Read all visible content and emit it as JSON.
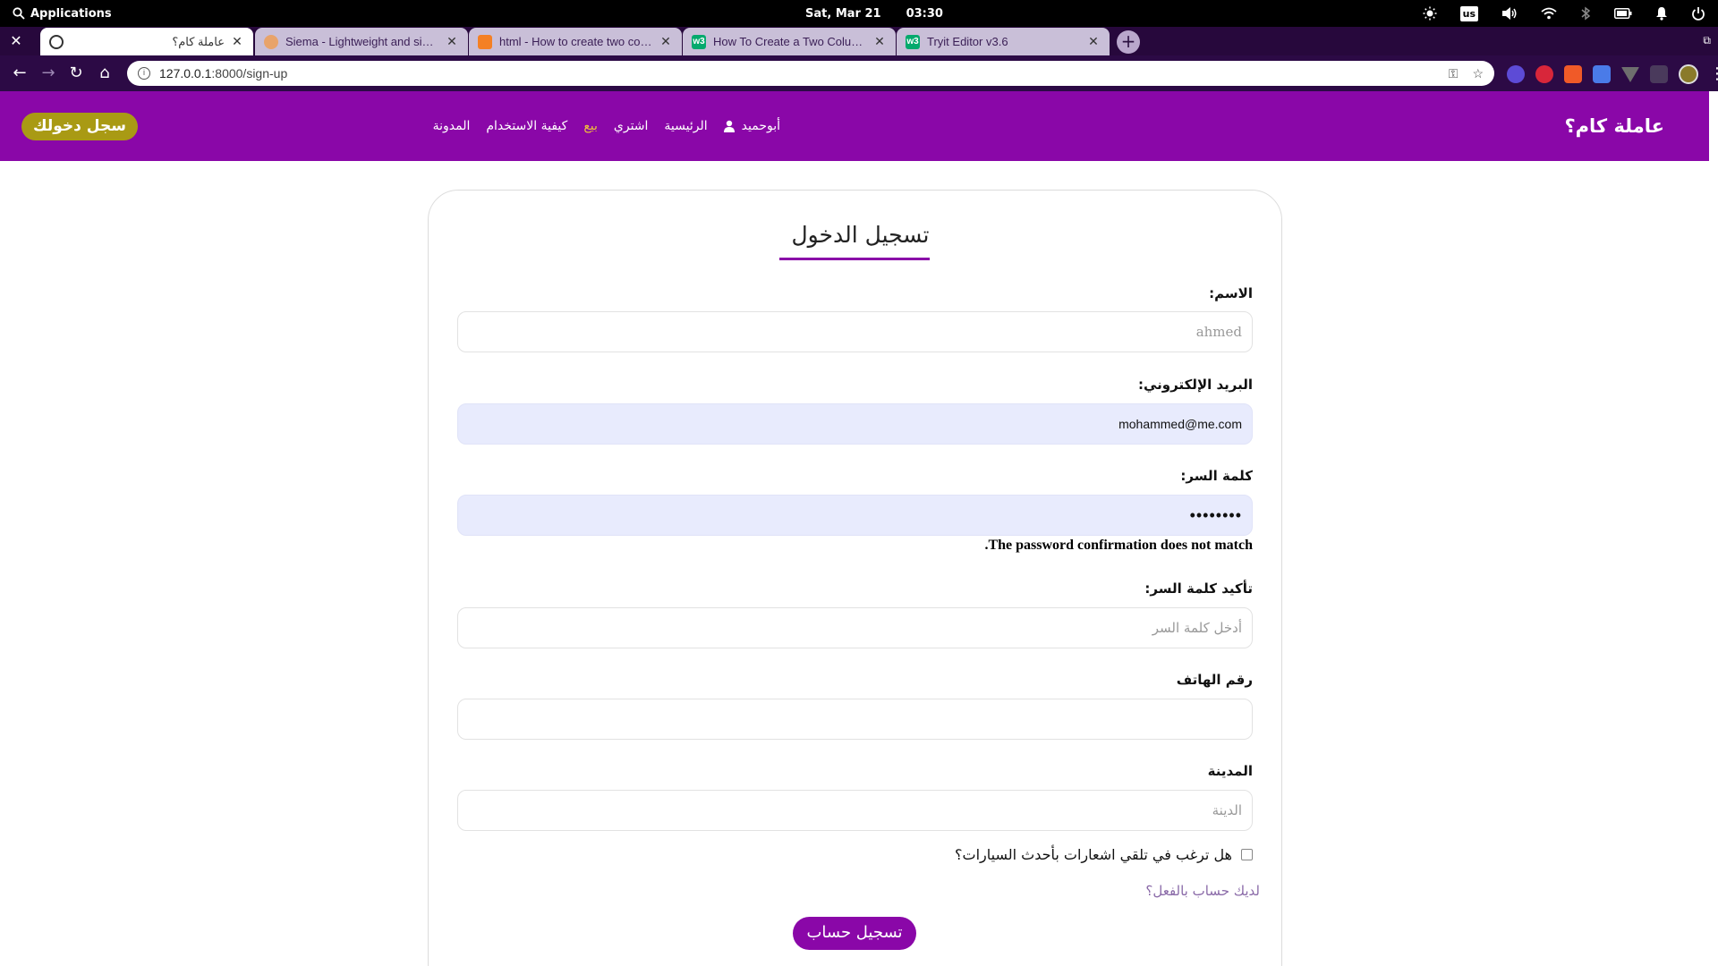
{
  "os_bar": {
    "applications_label": "Applications",
    "date": "Sat, Mar 21",
    "time": "03:30",
    "keyboard_layout": "us"
  },
  "browser": {
    "tabs": [
      {
        "title": "عاملة كام؟",
        "favicon": "globe-icon",
        "active": true
      },
      {
        "title": "Siema - Lightweight and simple",
        "favicon": "hand-icon",
        "active": false
      },
      {
        "title": "html - How to create two colum",
        "favicon": "stackoverflow-icon",
        "active": false
      },
      {
        "title": "How To Create a Two Column L",
        "favicon": "w3schools-icon",
        "active": false
      },
      {
        "title": "Tryit Editor v3.6",
        "favicon": "w3schools-icon",
        "active": false
      }
    ],
    "favicon_label": "w3",
    "address": {
      "host": "127.0.0.1",
      "path": ":8000/sign-up"
    }
  },
  "site": {
    "brand": "عاملة كام؟",
    "nav": {
      "user": "أبوحميد",
      "home": "الرئيسية",
      "buy": "اشتري",
      "sell": "بيع",
      "how_to": "كيفية الاستخدام",
      "blog": "المدونة"
    },
    "login_button": "سجل دخولك",
    "colors": {
      "header": "#8a07a8",
      "active_nav": "#f0c23a",
      "login_button": "#a99a14",
      "autofill": "#e8ebfd"
    }
  },
  "form": {
    "title": "تسجيل الدخول",
    "name": {
      "label": "الاسم:",
      "placeholder": "ahmed"
    },
    "email": {
      "label": "البريد الإلكتروني:",
      "value": "mohammed@me.com"
    },
    "password": {
      "label": "كلمة السر:",
      "value": "••••••••"
    },
    "password_error": ".The password confirmation does not match",
    "confirm_password": {
      "label": "تأكيد كلمة السر:",
      "placeholder": "أدخل كلمة السر"
    },
    "phone": {
      "label": "رقم الهاتف",
      "placeholder": ""
    },
    "city": {
      "label": "المدينة",
      "placeholder": "الدينة"
    },
    "notify_label": "هل ترغب في تلقي اشعارات بأحدث السيارات؟",
    "have_account_link": "لديك حساب بالفعل؟",
    "submit": "تسجيل حساب"
  }
}
